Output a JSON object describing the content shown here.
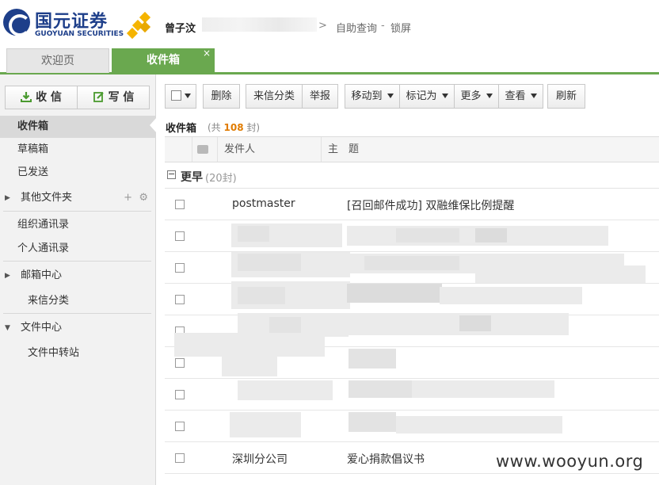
{
  "brand": {
    "name_cn": "国元证券",
    "name_en": "GUOYUAN SECURITIES",
    "primary_color": "#1e3f8a",
    "accent_color": "#f5b400"
  },
  "header": {
    "user_name": "曾子汶",
    "separator": ">",
    "link_search": "自助查询",
    "dash": "-",
    "link_lock": "锁屏"
  },
  "tabs": {
    "welcome": "欢迎页",
    "inbox": "收件箱",
    "close_symbol": "×",
    "active_color": "#6aa84f"
  },
  "sidebar": {
    "receive_label": "收 信",
    "write_label": "写 信",
    "items": {
      "inbox": "收件箱",
      "drafts": "草稿箱",
      "sent": "已发送",
      "other_folders": "其他文件夹",
      "org_contacts": "组织通讯录",
      "personal_contacts": "个人通讯录",
      "mail_center": "邮箱中心",
      "incoming_rules": "来信分类",
      "file_center": "文件中心",
      "file_transfer": "文件中转站"
    },
    "tools_add": "+",
    "tools_gear": "⚙"
  },
  "toolbar": {
    "delete": "删除",
    "classify": "来信分类",
    "report": "举报",
    "move_to": "移动到",
    "mark_as": "标记为",
    "more": "更多",
    "view": "查看",
    "refresh": "刷新"
  },
  "folder": {
    "title": "收件箱",
    "count_prefix": "(共 ",
    "count": "108",
    "count_suffix": " 封)"
  },
  "list_header": {
    "sender": "发件人",
    "subject": "主　题"
  },
  "group": {
    "toggle": "−",
    "label": "更早",
    "count": "(20封)"
  },
  "messages": [
    {
      "sender": "postmaster",
      "subject": "[召回邮件成功] 双融维保比例提醒"
    },
    {
      "sender": "",
      "subject": ""
    },
    {
      "sender": "",
      "subject": ""
    },
    {
      "sender": "",
      "subject": ""
    },
    {
      "sender": "",
      "subject": ""
    },
    {
      "sender": "",
      "subject": ""
    },
    {
      "sender": "",
      "subject": ""
    },
    {
      "sender": "",
      "subject": ""
    },
    {
      "sender": "深圳分公司",
      "subject": "爱心捐款倡议书"
    }
  ],
  "watermark": "www.wooyun.org"
}
